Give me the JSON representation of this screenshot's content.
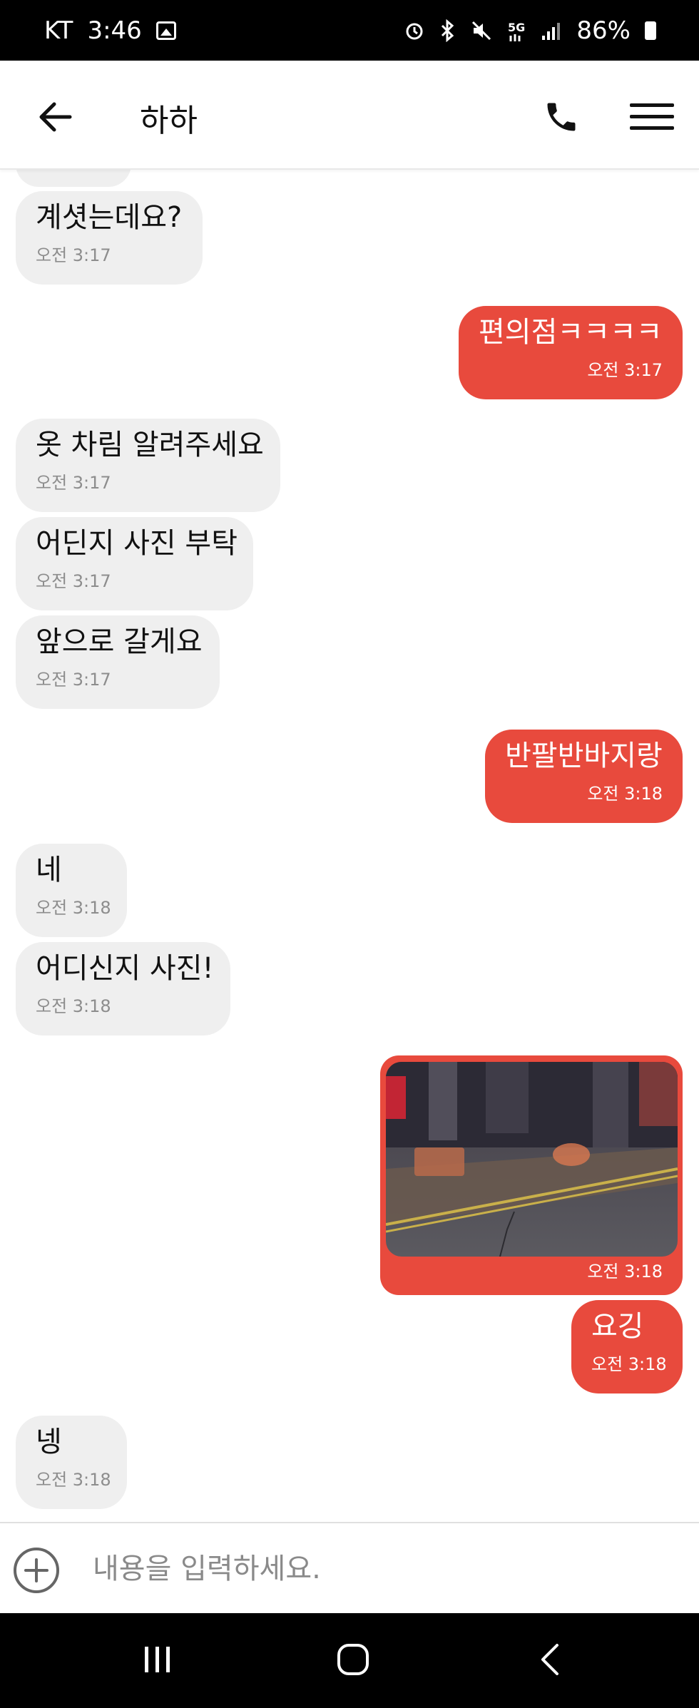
{
  "status_bar": {
    "carrier": "KT",
    "time": "3:46",
    "battery": "86%",
    "icons": [
      "gallery-icon",
      "alarm-icon",
      "bluetooth-icon",
      "mute-icon",
      "5g-icon",
      "signal-icon",
      "battery-icon"
    ]
  },
  "header": {
    "title": "하하",
    "back_icon": "arrow-left-icon",
    "call_icon": "phone-icon",
    "menu_icon": "hamburger-menu-icon"
  },
  "messages": [
    {
      "from": "other",
      "text": "계셧는데요?",
      "time": "오전 3:17"
    },
    {
      "from": "me",
      "text": "편의점ㅋㅋㅋㅋ",
      "time": "오전 3:17"
    },
    {
      "from": "other",
      "text": "옷 차림 알려주세요",
      "time": "오전 3:17"
    },
    {
      "from": "other",
      "text": "어딘지 사진 부탁",
      "time": "오전 3:17"
    },
    {
      "from": "other",
      "text": "앞으로 갈게요",
      "time": "오전 3:17"
    },
    {
      "from": "me",
      "text": "반팔반바지랑",
      "time": "오전 3:18"
    },
    {
      "from": "other",
      "text": "네",
      "time": "오전 3:18"
    },
    {
      "from": "other",
      "text": "어디신지 사진!",
      "time": "오전 3:18"
    },
    {
      "from": "me",
      "type": "photo",
      "time": "오전 3:18"
    },
    {
      "from": "me",
      "text": "요깅",
      "time": "오전 3:18"
    },
    {
      "from": "other",
      "text": "넹",
      "time": "오전 3:18"
    }
  ],
  "input": {
    "placeholder": "내용을 입력하세요.",
    "add_icon": "plus-circle-icon"
  },
  "nav": {
    "icons": [
      "recent-apps-icon",
      "home-icon",
      "back-icon"
    ]
  },
  "colors": {
    "outgoing_bubble": "#e84a3d",
    "incoming_bubble": "#efefef",
    "incoming_time": "#8d8d8d"
  }
}
